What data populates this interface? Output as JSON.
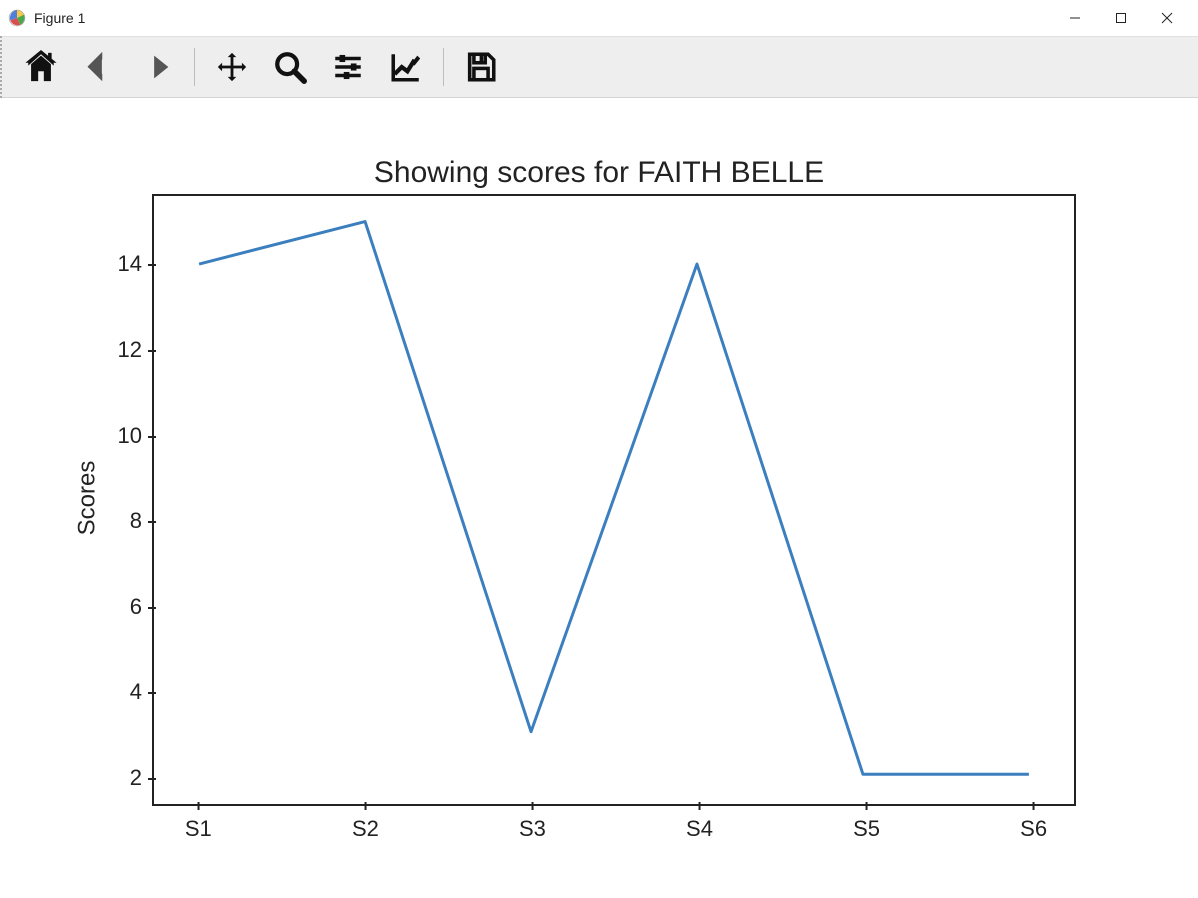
{
  "window": {
    "title": "Figure 1"
  },
  "toolbar": {
    "items": [
      "home",
      "back",
      "forward",
      "pan",
      "zoom",
      "configure",
      "axes-edit",
      "save"
    ]
  },
  "chart_data": {
    "type": "line",
    "title": "Showing scores for FAITH BELLE",
    "ylabel": "Scores",
    "xlabel": "",
    "categories": [
      "S1",
      "S2",
      "S3",
      "S4",
      "S5",
      "S6"
    ],
    "values": [
      14,
      15,
      3,
      14,
      2,
      2
    ],
    "yticks": [
      2,
      4,
      6,
      8,
      10,
      12,
      14
    ],
    "ylim": [
      1.3,
      15.6
    ],
    "line_color": "#3b7fbf"
  }
}
